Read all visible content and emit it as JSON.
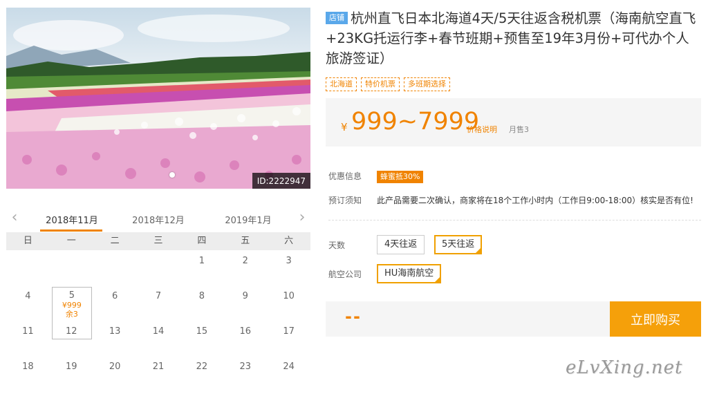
{
  "gallery": {
    "id_label": "ID:2222947"
  },
  "calendar": {
    "months": [
      "2018年11月",
      "2018年12月",
      "2019年1月"
    ],
    "weekdays": [
      "日",
      "一",
      "二",
      "三",
      "四",
      "五",
      "六"
    ],
    "rows": [
      [
        "",
        "",
        "",
        "",
        "1",
        "2",
        "3"
      ],
      [
        "4",
        "5",
        "6",
        "7",
        "8",
        "9",
        "10"
      ],
      [
        "11",
        "12",
        "13",
        "14",
        "15",
        "16",
        "17"
      ],
      [
        "18",
        "19",
        "20",
        "21",
        "22",
        "23",
        "24"
      ]
    ],
    "selected": {
      "day": "5",
      "price": "¥999",
      "remain": "余3"
    }
  },
  "product": {
    "badge": "店铺",
    "title": "杭州直飞日本北海道4天/5天往返含税机票（海南航空直飞+23KG托运行李+春节班期+预售至19年3月份+可代办个人旅游签证）",
    "tags": [
      "北海道",
      "特价机票",
      "多班期选择"
    ]
  },
  "price": {
    "currency": "¥",
    "value": "999~7999",
    "note": "价格说明",
    "sold": "月售3"
  },
  "info": {
    "promo_label": "优惠信息",
    "promo_badge": "蜂蜜抵30%",
    "notice_label": "预订须知",
    "notice_text": "此产品需要二次确认，商家将在18个工作小时内（工作日9:00-18:00）核实是否有位!"
  },
  "options": {
    "days_label": "天数",
    "days": [
      "4天往返",
      "5天往返"
    ],
    "airline_label": "航空公司",
    "airlines": [
      "HU海南航空"
    ]
  },
  "buy": {
    "total": "--",
    "button": "立即购买"
  },
  "watermark": "eLvXing.net",
  "colors": {
    "accent": "#f08300",
    "buy_button": "#f5a00a",
    "badge": "#5aa8ea",
    "active_border": "#f0a000"
  }
}
